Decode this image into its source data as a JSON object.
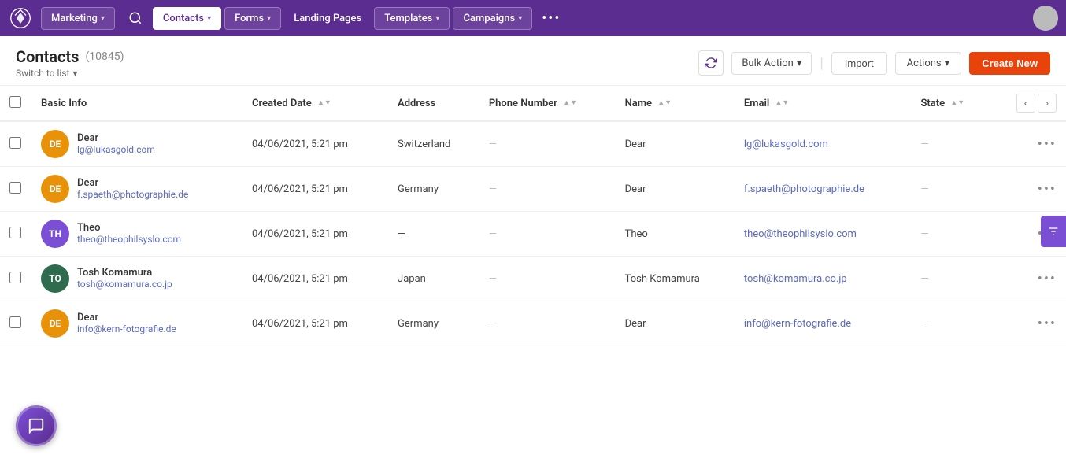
{
  "app": {
    "logo_text": "✦"
  },
  "topnav": {
    "items": [
      {
        "id": "marketing",
        "label": "Marketing",
        "has_dropdown": true
      },
      {
        "id": "contacts",
        "label": "Contacts",
        "has_dropdown": true,
        "active": true
      },
      {
        "id": "forms",
        "label": "Forms",
        "has_dropdown": true
      },
      {
        "id": "landing_pages",
        "label": "Landing Pages",
        "has_dropdown": false
      },
      {
        "id": "templates",
        "label": "Templates",
        "has_dropdown": true
      },
      {
        "id": "campaigns",
        "label": "Campaigns",
        "has_dropdown": true
      }
    ],
    "more_label": "•••"
  },
  "page": {
    "title": "Contacts",
    "count": "(10845)",
    "switch_to_list": "Switch to list"
  },
  "header_actions": {
    "bulk_action_label": "Bulk Action",
    "import_label": "Import",
    "actions_label": "Actions",
    "create_new_label": "Create New"
  },
  "table": {
    "columns": [
      {
        "id": "basic_info",
        "label": "Basic Info",
        "sortable": false
      },
      {
        "id": "created_date",
        "label": "Created Date",
        "sortable": true
      },
      {
        "id": "address",
        "label": "Address",
        "sortable": false
      },
      {
        "id": "phone_number",
        "label": "Phone Number",
        "sortable": true
      },
      {
        "id": "name",
        "label": "Name",
        "sortable": true
      },
      {
        "id": "email",
        "label": "Email",
        "sortable": true
      },
      {
        "id": "state",
        "label": "State",
        "sortable": true
      }
    ],
    "rows": [
      {
        "id": 1,
        "initials": "DE",
        "avatar_color": "#e8920a",
        "name": "Dear",
        "contact_email": "lg@lukasgold.com",
        "created_date": "04/06/2021, 5:21 pm",
        "address": "Switzerland",
        "phone_number": "—",
        "full_name": "Dear",
        "email_link": "lg@lukasgold.com",
        "state": "—"
      },
      {
        "id": 2,
        "initials": "DE",
        "avatar_color": "#e8920a",
        "name": "Dear",
        "contact_email": "f.spaeth@photographie.de",
        "created_date": "04/06/2021, 5:21 pm",
        "address": "Germany",
        "phone_number": "—",
        "full_name": "Dear",
        "email_link": "f.spaeth@photographie.de",
        "state": "—"
      },
      {
        "id": 3,
        "initials": "TH",
        "avatar_color": "#7b4fd4",
        "name": "Theo",
        "contact_email": "theo@theophilsyslo.com",
        "created_date": "04/06/2021, 5:21 pm",
        "address": "—",
        "phone_number": "—",
        "full_name": "Theo",
        "email_link": "theo@theophilsyslo.com",
        "state": "—"
      },
      {
        "id": 4,
        "initials": "TO",
        "avatar_color": "#2e6b4f",
        "name": "Tosh Komamura",
        "contact_email": "tosh@komamura.co.jp",
        "created_date": "04/06/2021, 5:21 pm",
        "address": "Japan",
        "phone_number": "—",
        "full_name": "Tosh Komamura",
        "email_link": "tosh@komamura.co.jp",
        "state": "—"
      },
      {
        "id": 5,
        "initials": "DE",
        "avatar_color": "#e8920a",
        "name": "Dear",
        "contact_email": "info@kern-fotografie.de",
        "created_date": "04/06/2021, 5:21 pm",
        "address": "Germany",
        "phone_number": "—",
        "full_name": "Dear",
        "email_link": "info@kern-fotografie.de",
        "state": "—"
      }
    ]
  },
  "pagination": {
    "prev_label": "‹",
    "next_label": "›"
  },
  "cursor": "pointer"
}
